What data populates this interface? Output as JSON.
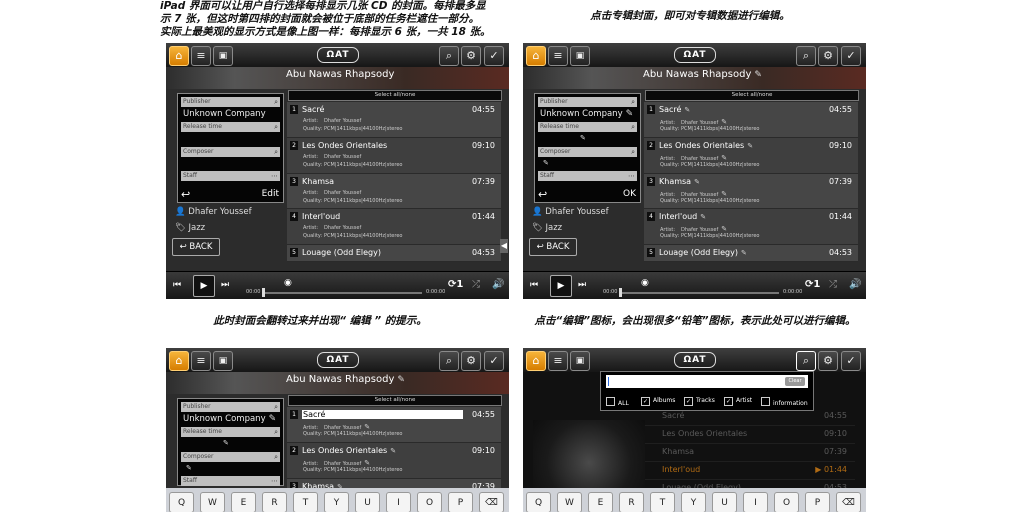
{
  "captions": {
    "c1_l1": "iPad 界面可以让用户自行选择每排显示几张 CD 的封面。每排最多显",
    "c1_l2": "示 7 张，但这时第四排的封面就会被位于底部的任务栏遮住一部分。",
    "c1_l3": "实际上最美观的显示方式是像上图一样：每排显示 6 张，一共 18 张。",
    "c2": "点击专辑封面，即可对专辑数据进行编辑。",
    "c3": "此时封面会翻转过来并出现“ 编辑 ” 的提示。",
    "c4": "点击“编辑”图标，会出现很多“铅笔”图标，表示此处可以进行编辑。"
  },
  "app": {
    "logo": "ΩAT",
    "album_title": "Abu Nawas Rhapsody",
    "select_all": "Select all/none",
    "artist": "Dhafer Youssef",
    "genre": "Jazz",
    "back": "BACK",
    "edit": "Edit",
    "ok": "OK",
    "time_current": "00:00",
    "time_total": "0:00:00",
    "repeat": "1"
  },
  "fields": {
    "publisher": "Publisher",
    "publisher_value": "Unknown Company",
    "release_time": "Release time",
    "composer": "Composer",
    "staff": "Staff"
  },
  "tracks": [
    {
      "num": "1",
      "title": "Sacré",
      "time": "04:55",
      "artist": "Dhafer Youssef",
      "quality": "PCM|1411kbps|44100Hz|stereo"
    },
    {
      "num": "2",
      "title": "Les Ondes Orientales",
      "time": "09:10",
      "artist": "Dhafer Youssef",
      "quality": "PCM|1411kbps|44100Hz|stereo"
    },
    {
      "num": "3",
      "title": "Khamsa",
      "time": "07:39",
      "artist": "Dhafer Youssef",
      "quality": "PCM|1411kbps|44100Hz|stereo"
    },
    {
      "num": "4",
      "title": "Interl'oud",
      "time": "01:44",
      "artist": "Dhafer Youssef",
      "quality": "PCM|1411kbps|44100Hz|stereo"
    },
    {
      "num": "5",
      "title": "Louage (Odd Elegy)",
      "time": "04:53"
    }
  ],
  "labels": {
    "artist": "Artist:",
    "quality": "Quality:"
  },
  "search": {
    "clear": "Clear",
    "opt_all": "ALL",
    "opt_albums": "Albums",
    "opt_tracks": "Tracks",
    "opt_artist": "Artist",
    "opt_info": "information"
  },
  "keyboard": [
    "Q",
    "W",
    "E",
    "R",
    "T",
    "Y",
    "U",
    "I",
    "O",
    "P"
  ],
  "colors": {
    "accent": "#f0a22a",
    "background": "#2c2c2c"
  }
}
